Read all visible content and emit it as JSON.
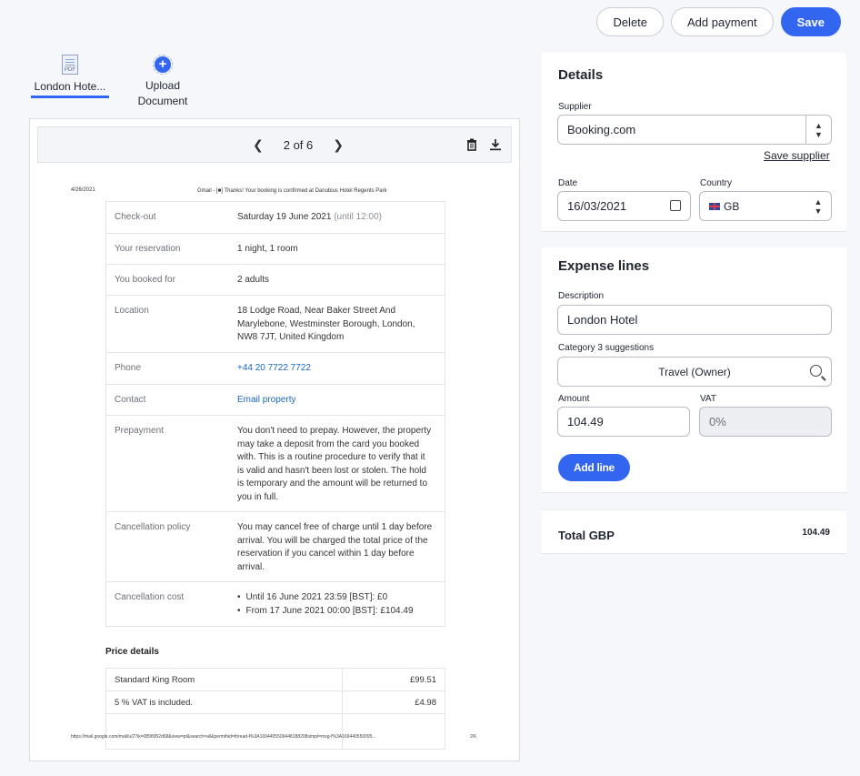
{
  "actions": {
    "delete": "Delete",
    "add_payment": "Add payment",
    "save": "Save"
  },
  "files": {
    "active_name": "London Hote...",
    "pdf_badge": "PDF",
    "upload_label": "Upload Document"
  },
  "viewer": {
    "page_indicator": "2 of 6",
    "doc": {
      "date": "4/26/2021",
      "title": "Gmail - [■] Thanks! Your booking is confirmed at Danubius Hotel Regents Park",
      "rows": [
        {
          "key": "Check-out",
          "value": "Saturday 19 June 2021",
          "extra": "(until 12:00)"
        },
        {
          "key": "Your reservation",
          "value": "1 night, 1 room"
        },
        {
          "key": "You booked for",
          "value": "2 adults"
        },
        {
          "key": "Location",
          "value": "18 Lodge Road, Near Baker Street And Marylebone, Westminster Borough, London, NW8 7JT, United Kingdom"
        },
        {
          "key": "Phone",
          "value": "+44 20 7722 7722"
        },
        {
          "key": "Contact",
          "value": "Email property"
        },
        {
          "key": "Prepayment",
          "value": "You don't need to prepay. However, the property may take a deposit from the card you booked with. This is a routine procedure to verify that it is valid and hasn't been lost or stolen. The hold is temporary and the amount will be returned to you in full."
        },
        {
          "key": "Cancellation policy",
          "value": "You may cancel free of charge until 1 day before arrival. You will be charged the total price of the reservation if you cancel within 1 day before arrival."
        },
        {
          "key": "Cancellation cost",
          "bullet1": "Until 16 June 2021 23:59 [BST]: £0",
          "bullet2": "From 17 June 2021 00:00 [BST]: £104.49"
        }
      ],
      "price_title": "Price details",
      "price_rows": [
        {
          "label": "Standard King Room",
          "amount": "£99.51"
        },
        {
          "label": "5 % VAT is included.",
          "amount": "£4.98"
        }
      ],
      "footer_url": "https://mail.google.com/mail/u/2?ik=0898952d68&view=pt&search=all&permthid=thread-f%3A1694405509448188208simpl=msg-f%3A169440550095...",
      "footer_page": "2/6"
    }
  },
  "details": {
    "heading": "Details",
    "supplier_label": "Supplier",
    "supplier_value": "Booking.com",
    "save_supplier": "Save supplier",
    "date_label": "Date",
    "date_value": "16/03/2021",
    "country_label": "Country",
    "country_value": "GB"
  },
  "expense": {
    "heading": "Expense lines",
    "description_label": "Description",
    "description_value": "London Hotel",
    "category_label": "Category 3 suggestions",
    "category_value": "Travel (Owner)",
    "amount_label": "Amount",
    "amount_value": "104.49",
    "vat_label": "VAT",
    "vat_value": "0%",
    "add_line": "Add line"
  },
  "total": {
    "label": "Total GBP",
    "value": "104.49"
  }
}
